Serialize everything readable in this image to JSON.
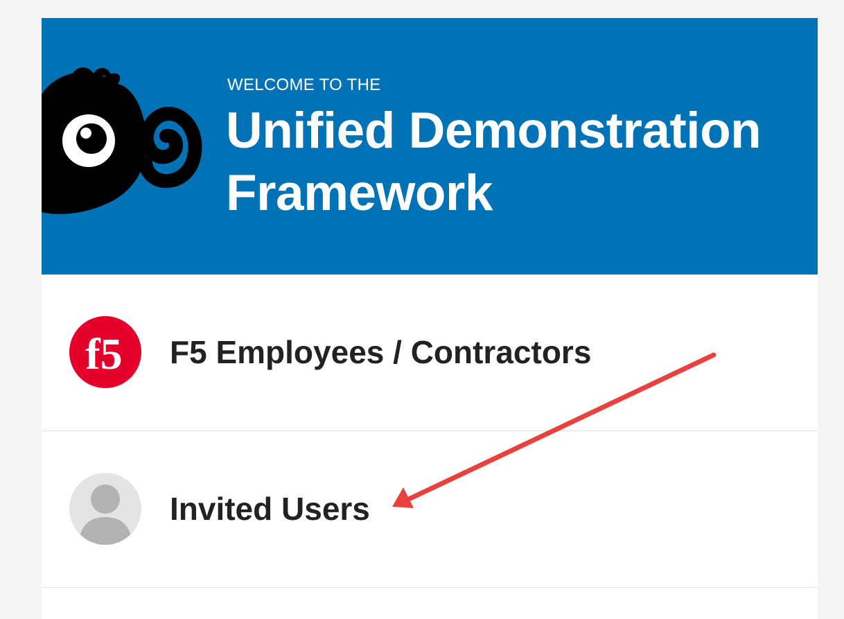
{
  "hero": {
    "welcome_text": "WELCOME TO THE",
    "title": "Unified Demonstration Framework",
    "background_color": "#0072b5",
    "mascot_icon": "mascot-icon"
  },
  "login_options": [
    {
      "label": "F5 Employees / Contractors",
      "icon": "f5-logo-icon",
      "icon_color": "#e4002b"
    },
    {
      "label": "Invited Users",
      "icon": "user-avatar-icon",
      "icon_color": "#bdbdbd"
    }
  ],
  "annotation": {
    "arrow_color": "#e8413e",
    "icon": "red-arrow-icon"
  }
}
